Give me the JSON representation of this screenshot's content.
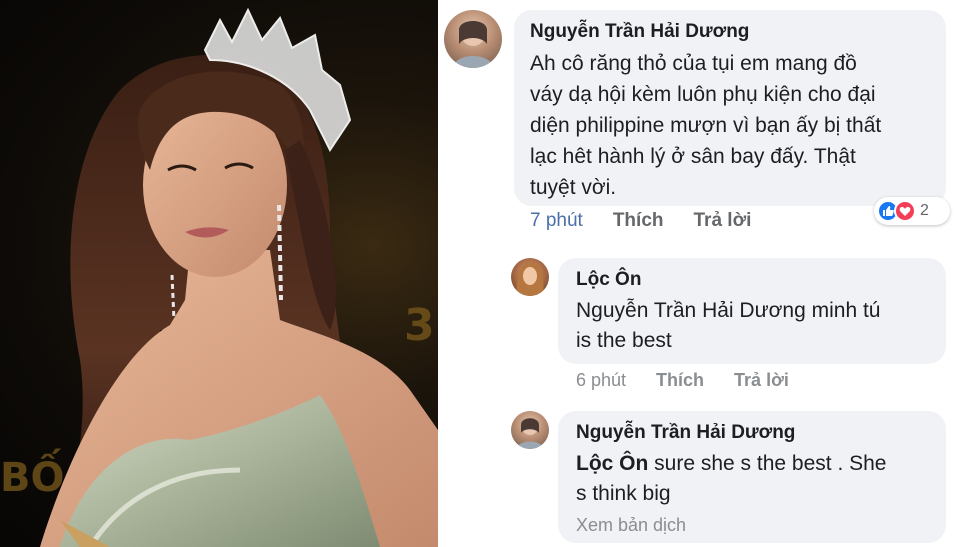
{
  "colors": {
    "link_blue": "#4b6fa8",
    "meta_grey": "#65676b",
    "bubble_bg": "#f0f2f5",
    "like_blue": "#1877f2",
    "love_red": "#f33e58"
  },
  "photo": {
    "description_icon": "pageant-photo",
    "bg_glyph_1": "3",
    "bg_glyph_2": "BỐ"
  },
  "comments": [
    {
      "author": "Nguyễn Trần Hải Dương",
      "text_lines": [
        "Ah cô răng thỏ của tụi em mang đồ",
        "váy dạ hội kèm luôn phụ kiện cho đại",
        "diện philippine mượn vì bạn ấy bị thất",
        "lạc hêt hành lý ở sân bay đấy. Thật",
        "tuyệt vời."
      ],
      "time": "7 phút",
      "like": "Thích",
      "reply": "Trả lời",
      "reaction_count": "2",
      "reaction_icons": [
        "like-icon",
        "love-icon"
      ]
    },
    {
      "author": "Lộc Ôn",
      "text_lines": [
        "Nguyễn Trần Hải Dương minh tú",
        "is the best"
      ],
      "time": "6 phút",
      "like": "Thích",
      "reply": "Trả lời"
    },
    {
      "author": "Nguyễn Trần Hải Dương",
      "mention": "Lộc Ôn",
      "text_line1_rest": " sure she s the best . She",
      "text_line2": "s think big",
      "see_translation": "Xem bản dịch"
    }
  ]
}
